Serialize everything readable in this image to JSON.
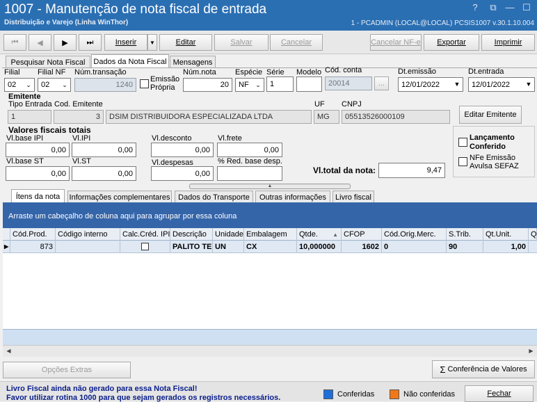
{
  "window": {
    "title": "1007 - Manutenção de nota fiscal de entrada",
    "subtitle": "Distribuição e Varejo (Linha WinThor)",
    "info": "1 - PCADMIN (LOCAL@LOCAL)   PCSIS1007  v.30.1.10.004",
    "controls": [
      "?",
      "⧉",
      "—",
      "☐"
    ]
  },
  "toolbar": {
    "first": "⏮",
    "prev": "◀",
    "next": "▶",
    "last": "⏭",
    "inserir": "Inserir",
    "inserir_dd": "▼",
    "editar": "Editar",
    "salvar": "Salvar",
    "cancelar": "Cancelar",
    "cancelar_nfe": "Cancelar NF-e",
    "exportar": "Exportar",
    "imprimir": "Imprimir"
  },
  "tabs": [
    "Pesquisar Nota Fiscal",
    "Dados da Nota Fiscal",
    "Mensagens"
  ],
  "form": {
    "filial_label": "Filial",
    "filial_value": "02",
    "filial_nf_label": "Filial NF",
    "filial_nf_value": "02",
    "num_transacao_label": "Núm.transação",
    "num_transacao_value": "1240",
    "emissao_propria_label": "Emissão\nPrópria",
    "num_nota_label": "Núm.nota",
    "num_nota_value": "20",
    "especie_label": "Espécie",
    "especie_value": "NF",
    "serie_label": "Série",
    "serie_value": "1",
    "modelo_label": "Modelo",
    "modelo_value": "",
    "cod_conta_label": "Cód. conta",
    "cod_conta_value": "20014",
    "cod_conta_btn": "...",
    "dt_emissao_label": "Dt.emissão",
    "dt_emissao_value": "12/01/2022",
    "dt_entrada_label": "Dt.entrada",
    "dt_entrada_value": "12/01/2022"
  },
  "emitente": {
    "section": "Emitente",
    "tipo_entrada_label": "Tipo Entrada",
    "tipo_entrada_value": "1",
    "cod_emitente_label": "Cod. Emitente",
    "cod_emitente_value": "3",
    "nome_value": "DSIM DISTRIBUIDORA ESPECIALIZADA LTDA",
    "uf_label": "UF",
    "uf_value": "MG",
    "cnpj_label": "CNPJ",
    "cnpj_value": "05513526000109",
    "editar_btn": "Editar Emitente"
  },
  "valores": {
    "section": "Valores fiscais totais",
    "base_ipi_label": "Vl.base IPI",
    "base_ipi_value": "0,00",
    "ipi_label": "Vl.IPI",
    "ipi_value": "0,00",
    "desconto_label": "Vl.desconto",
    "desconto_value": "0,00",
    "frete_label": "Vl.frete",
    "frete_value": "0,00",
    "base_st_label": "Vl.base ST",
    "base_st_value": "0,00",
    "st_label": "Vl.ST",
    "st_value": "0,00",
    "despesas_label": "Vl.despesas",
    "despesas_value": "0,00",
    "red_base_label": "% Red. base desp.",
    "red_base_value": "",
    "total_label": "Vl.total da nota:",
    "total_value": "9,47"
  },
  "side": {
    "lancamento_label": "Lançamento\nConferido",
    "nfe_label": "NFe Emissão\nAvulsa SEFAZ"
  },
  "subtabs": [
    "Ítens da nota",
    "Informações complementares",
    "Dados do Transporte",
    "Outras informações",
    "Livro fiscal"
  ],
  "grid": {
    "group_hint": "Arraste um cabeçalho de coluna aqui para agrupar por essa coluna",
    "columns": [
      "Cód.Prod.",
      "Código interno",
      "Calc.Créd. IPI",
      "Descrição",
      "Unidade",
      "Embalagem",
      "Qtde.",
      "CFOP",
      "Cód.Orig.Merc.",
      "S.Trib.",
      "Qt.Unit.",
      "Q"
    ],
    "sort_indicator": "▲",
    "rows": [
      {
        "cod_prod": "873",
        "codigo_interno": "",
        "descricao": "PALITO TE",
        "unidade": "UN",
        "embalagem": "CX",
        "qtde": "10,000000",
        "cfop": "1602",
        "cod_orig": "0",
        "s_trib": "90",
        "qt_unit": "1,00"
      }
    ]
  },
  "footer": {
    "opcoes_btn": "Opções Extras",
    "conferencia_btn": "Conferência de Valores",
    "msg1": "Livro Fiscal ainda não gerado para essa Nota Fiscal!",
    "msg2": "Favor utilizar rotina 1000 para que sejam gerados os registros necessários.",
    "conferidas": "Conferidas",
    "nao_conferidas": "Não conferidas",
    "fechar_btn": "Fechar"
  },
  "colors": {
    "title_bar": "#2b6fb3",
    "grid_header": "#3565a9",
    "conferidas": "#1e6fd9",
    "nao_conferidas": "#f07818",
    "message": "#0a1e8c"
  }
}
